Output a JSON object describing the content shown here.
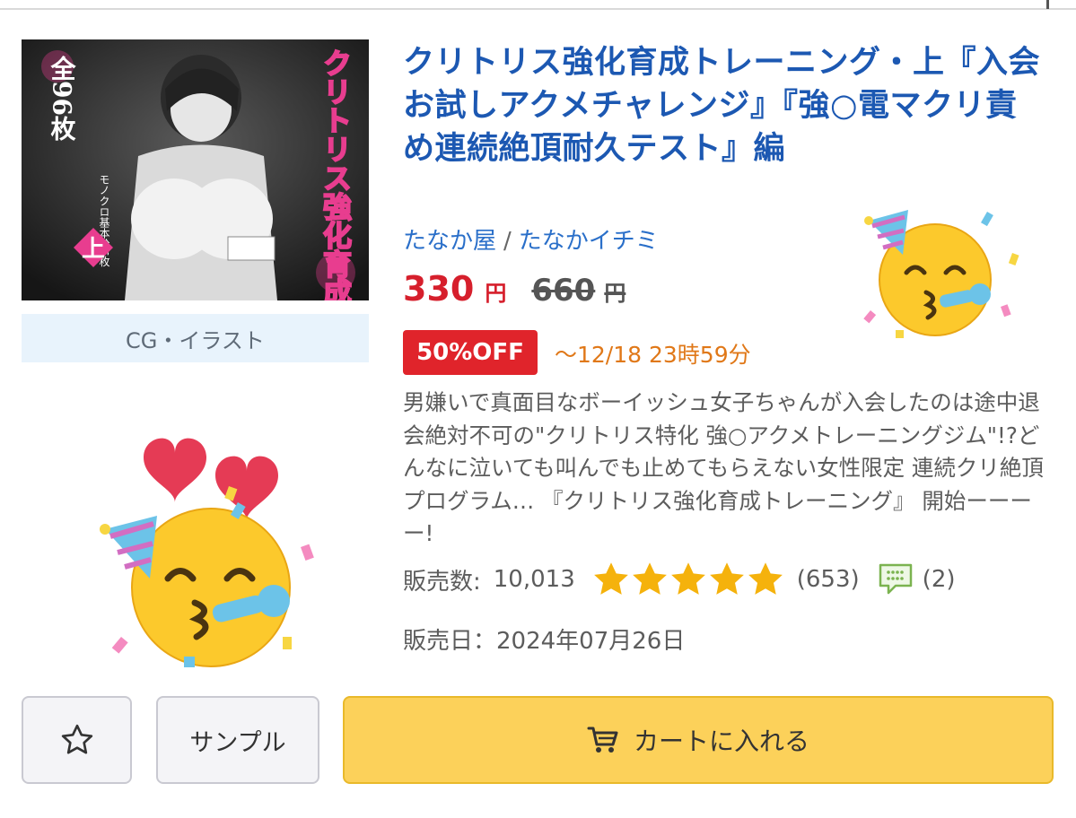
{
  "product": {
    "title": "クリトリス強化育成トレーニング・上『入会お試しアクメチャレンジ』『強○電マクリ責め連続絶頂耐久テスト』編",
    "circle": "たなか屋",
    "separator": "/",
    "author": "たなかイチミ",
    "category": "CG・イラスト",
    "cover_text": {
      "main": "クリトリス強化育成トレーニング",
      "volume": "上",
      "count": "全96枚",
      "sub": "モノクロ基本絵6枚"
    }
  },
  "price": {
    "current": "330",
    "current_unit": "円",
    "original": "660",
    "original_unit": "円",
    "discount": "50%OFF",
    "deadline": "～12/18 23時59分"
  },
  "description": "男嫌いで真面目なボーイッシュ女子ちゃんが入会したのは途中退会絶対不可の\"クリトリス特化 強○アクメトレーニングジム\"!?どんなに泣いても叫んでも止めてもらえない女性限定 連続クリ絶頂プログラム… 『クリトリス強化育成トレーニング』 開始ーーーー!",
  "stats": {
    "sales_label": "販売数:",
    "sales_value": "10,013",
    "rating": 5,
    "review_count": "(653)",
    "comment_count": "(2)"
  },
  "release": {
    "label": "販売日：",
    "date": "2024年07月26日"
  },
  "buttons": {
    "sample": "サンプル",
    "cart": "カートに入れる"
  },
  "colors": {
    "title": "#1c58b2",
    "link": "#2a6fc9",
    "price": "#d61f2c",
    "badge": "#e0242b",
    "deadline": "#e07818",
    "star": "#f5b20c",
    "cart_button": "#fcd15a"
  },
  "icons": {
    "favorite": "star-outline-icon",
    "cart": "cart-icon",
    "comment": "comment-icon",
    "rating": "star-filled-icon",
    "sticker": "partying-face-emoji"
  }
}
